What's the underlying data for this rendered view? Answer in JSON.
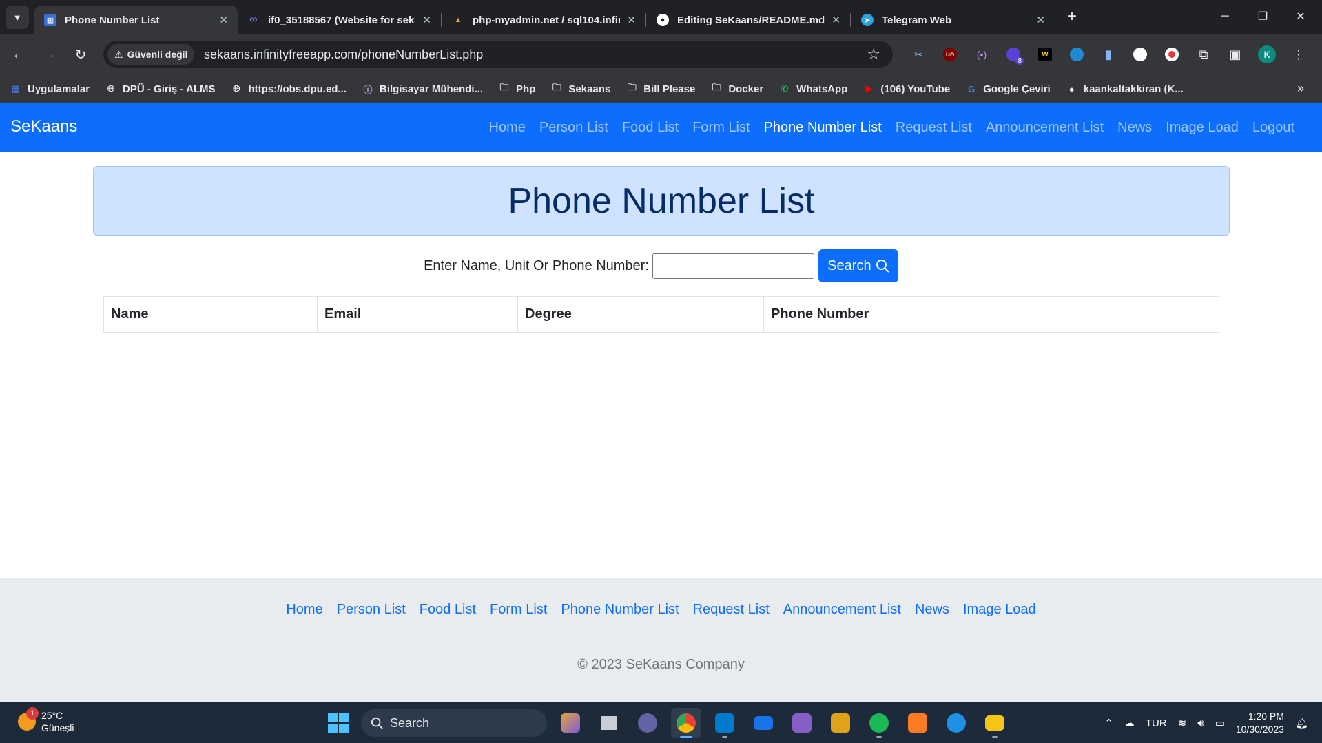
{
  "browser": {
    "tabs": [
      {
        "title": "Phone Number List",
        "active": true
      },
      {
        "title": "if0_35188567 (Website for seka",
        "active": false
      },
      {
        "title": "php-myadmin.net / sql104.infin",
        "active": false
      },
      {
        "title": "Editing SeKaans/README.md a",
        "active": false
      },
      {
        "title": "Telegram Web",
        "active": false
      }
    ],
    "security_label": "Güvenli değil",
    "url": "sekaans.infinityfreeapp.com/phoneNumberList.php",
    "extension_badge": "8",
    "profile_initial": "K",
    "bookmarks": [
      {
        "label": "Uygulamalar",
        "icon": "apps-grid-icon"
      },
      {
        "label": "DPÜ - Giriş - ALMS",
        "icon": "globe-icon"
      },
      {
        "label": "https://obs.dpu.ed...",
        "icon": "globe-icon"
      },
      {
        "label": "Bilgisayar Mühendi...",
        "icon": "info-icon"
      },
      {
        "label": "Php",
        "icon": "folder-icon"
      },
      {
        "label": "Sekaans",
        "icon": "folder-icon"
      },
      {
        "label": "Bill Please",
        "icon": "folder-icon"
      },
      {
        "label": "Docker",
        "icon": "folder-icon"
      },
      {
        "label": "WhatsApp",
        "icon": "whatsapp-icon"
      },
      {
        "label": "(106) YouTube",
        "icon": "youtube-icon"
      },
      {
        "label": "Google Çeviri",
        "icon": "translate-icon"
      },
      {
        "label": "kaankaltakkiran (K...",
        "icon": "github-icon"
      }
    ]
  },
  "site": {
    "brand": "SeKaans",
    "nav": [
      "Home",
      "Person List",
      "Food List",
      "Form List",
      "Phone Number List",
      "Request List",
      "Announcement List",
      "News",
      "Image Load",
      "Logout"
    ],
    "active_nav": "Phone Number List",
    "heading": "Phone Number List",
    "search": {
      "label": "Enter Name, Unit Or Phone Number:",
      "value": "",
      "button": "Search"
    },
    "table": {
      "columns": [
        "Name",
        "Email",
        "Degree",
        "Phone Number"
      ],
      "rows": []
    },
    "footer": {
      "links": [
        "Home",
        "Person List",
        "Food List",
        "Form List",
        "Phone Number List",
        "Request List",
        "Announcement List",
        "News",
        "Image Load"
      ],
      "copyright": "© 2023 SeKaans Company"
    }
  },
  "taskbar": {
    "weather_temp": "25°C",
    "weather_desc": "Güneşli",
    "weather_badge": "1",
    "search_label": "Search",
    "language": "TUR",
    "time": "1:20 PM",
    "date": "10/30/2023"
  },
  "colors": {
    "primary": "#0d6efd",
    "hero_bg": "#cfe2ff",
    "hero_text": "#052c65"
  }
}
